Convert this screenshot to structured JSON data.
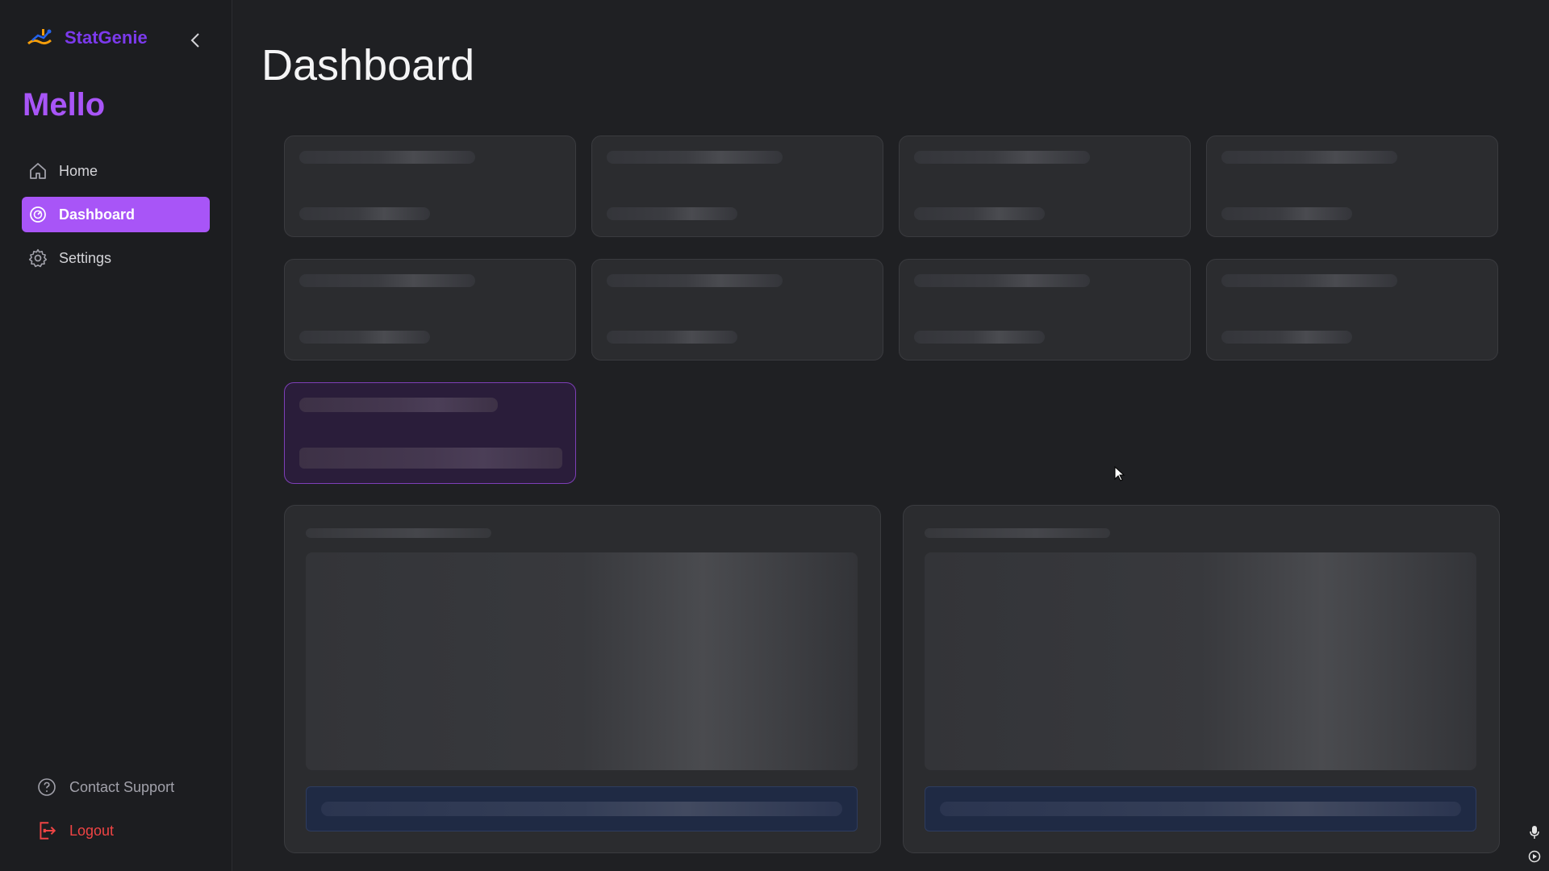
{
  "sidebar": {
    "brand_name": "StatGenie",
    "workspace": "Mello",
    "nav": [
      {
        "label": "Home",
        "icon": "home-icon"
      },
      {
        "label": "Dashboard",
        "icon": "dashboard-gauge-icon",
        "active": true
      },
      {
        "label": "Settings",
        "icon": "gear-icon"
      }
    ],
    "contact_support": "Contact Support",
    "logout": "Logout"
  },
  "main": {
    "title": "Dashboard"
  },
  "colors": {
    "accent": "#a855f7",
    "brand": "#7c3aed",
    "logout": "#ef4444"
  }
}
